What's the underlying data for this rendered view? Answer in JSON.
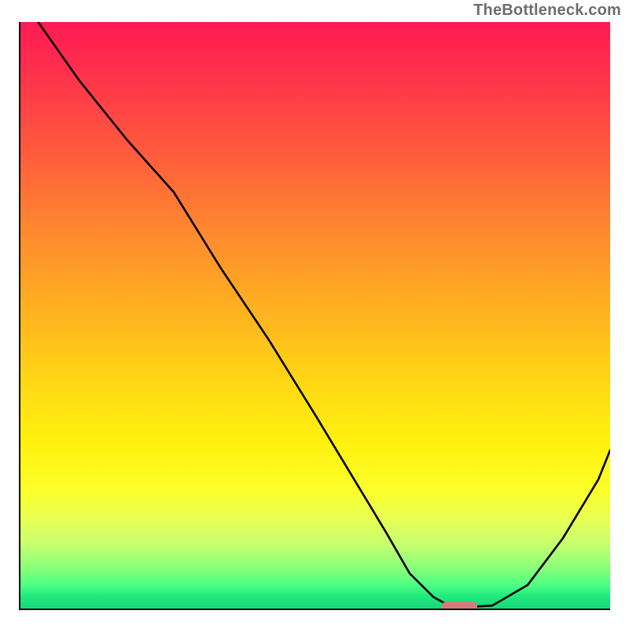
{
  "watermark": "TheBottleneck.com",
  "colors": {
    "gradient_top": "#ff1a53",
    "gradient_bottom": "#18d878",
    "axis": "#000000",
    "curve": "#000000",
    "pill": "#d87a7a",
    "watermark_text": "#6d6d6d"
  },
  "chart_data": {
    "type": "line",
    "title": "",
    "xlabel": "",
    "ylabel": "",
    "xlim": [
      0,
      100
    ],
    "ylim": [
      0,
      100
    ],
    "grid": false,
    "legend": false,
    "series": [
      {
        "name": "curve",
        "x": [
          3,
          10,
          18,
          26,
          34,
          42,
          50,
          56,
          62,
          66,
          70,
          73,
          76,
          80,
          86,
          92,
          98,
          100
        ],
        "y": [
          100,
          90,
          80,
          71,
          58,
          46,
          33,
          23,
          13,
          6,
          2,
          0.3,
          0.3,
          0.5,
          4,
          12,
          22,
          27
        ]
      }
    ],
    "marker": {
      "shape": "rounded-rect",
      "x": 74.5,
      "y": 0.4,
      "width": 6,
      "height": 1.5
    }
  }
}
